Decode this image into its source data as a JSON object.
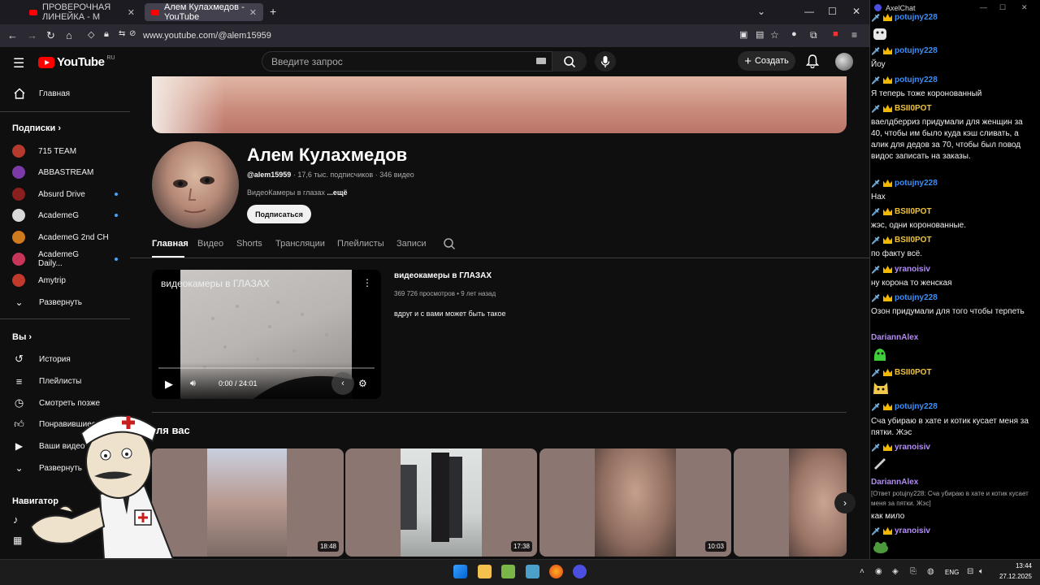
{
  "browser": {
    "tabs": [
      {
        "label": "ПРОВЕРОЧНАЯ ЛИНЕЙКА - M"
      },
      {
        "label": "Алем Кулахмедов - YouTube"
      }
    ],
    "url": "www.youtube.com/@alem15959"
  },
  "yt": {
    "logo_text": "YouTube",
    "logo_region": "RU",
    "search_placeholder": "Введите запрос",
    "create_label": "Создать"
  },
  "sidebar": {
    "home": "Главная",
    "subs_header": "Подписки",
    "subs": [
      {
        "name": "715 TEAM",
        "color": "#b33a2c"
      },
      {
        "name": "ABBASTREAM",
        "color": "#7b3aa8"
      },
      {
        "name": "Absurd Drive",
        "color": "#8a1f1f"
      },
      {
        "name": "AcademeG",
        "color": "#d9d9d9"
      },
      {
        "name": "AcademeG 2nd CH",
        "color": "#d07a1e"
      },
      {
        "name": "AcademeG Daily...",
        "color": "#c7355a"
      },
      {
        "name": "Amytrip",
        "color": "#c0392b"
      }
    ],
    "expand": "Развернуть",
    "you_header": "Вы",
    "you_items": [
      "История",
      "Плейлисты",
      "Смотреть позже",
      "Понравившиеся",
      "Ваши видео",
      "Развернуть"
    ],
    "nav_header": "Навигатор"
  },
  "channel": {
    "name": "Алем Кулахмедов",
    "handle": "@alem15959",
    "stats": " · 17,6 тыс. подписчиков · 346 видео",
    "desc": "ВидеоКамеры в глазах ",
    "more": "...ещё",
    "subscribe": "Подписаться",
    "tabs": [
      "Главная",
      "Видео",
      "Shorts",
      "Трансляции",
      "Плейлисты",
      "Записи"
    ]
  },
  "featured": {
    "overlay_title": "видеокамеры в ГЛАЗАХ",
    "time": "0:00 / 24:01",
    "title": "видеокамеры в ГЛАЗАХ",
    "meta": "369 726 просмотров • 9 лет назад",
    "desc": "вдруг и с вами может быть такое"
  },
  "foryou": {
    "header": "ля вас",
    "durations": [
      "18:48",
      "17:38",
      "10:03",
      ""
    ]
  },
  "chat": {
    "title": "AxelChat",
    "messages": [
      {
        "user": "potujny228",
        "text": "Йоу",
        "ucolor": "#3e8ef7"
      },
      {
        "user": "potujny228",
        "text": "Я теперь тоже коронованный",
        "ucolor": "#3e8ef7"
      },
      {
        "user": "BSII0POT",
        "text": "ваелдберриз придумали для женщин за 40, чтобы им было куда кэш сливать, а алик для дедов за 70, чтобы был повод видос записать на заказы.",
        "ucolor": "#f0c43a"
      },
      {
        "user": "potujny228",
        "text": "Нах",
        "ucolor": "#3e8ef7"
      },
      {
        "user": "BSII0POT",
        "text": "жэс, одни коронованные.",
        "ucolor": "#f0c43a"
      },
      {
        "user": "BSII0POT",
        "text": "по факту всё.",
        "ucolor": "#f0c43a"
      },
      {
        "user": "yranoisiv",
        "text": "ну корона то женская",
        "ucolor": "#b58cff"
      },
      {
        "user": "potujny228",
        "text": "Озон придумали для того чтобы терпеть",
        "ucolor": "#3e8ef7"
      },
      {
        "user": "DariannAlex",
        "text": "",
        "ucolor": "#b38cf2"
      },
      {
        "user": "BSII0POT",
        "text": "",
        "ucolor": "#f0c43a"
      },
      {
        "user": "potujny228",
        "text": "Сча убираю в хате и котик кусает меня за пятки. Жэс",
        "ucolor": "#3e8ef7"
      },
      {
        "user": "yranoisiv",
        "text": "",
        "ucolor": "#b58cff"
      },
      {
        "user": "DariannAlex",
        "text": "как мило",
        "ucolor": "#b38cf2"
      },
      {
        "user": "yranoisiv",
        "text": "",
        "ucolor": "#b58cff"
      }
    ],
    "top_user": "potujny228",
    "reply": "[Ответ potujny228: Сча убираю в хате и котик кусает меня за пятки. Жэс]"
  },
  "tray": {
    "lang": "ENG",
    "time": "13:44",
    "date": "27.12.2025"
  }
}
